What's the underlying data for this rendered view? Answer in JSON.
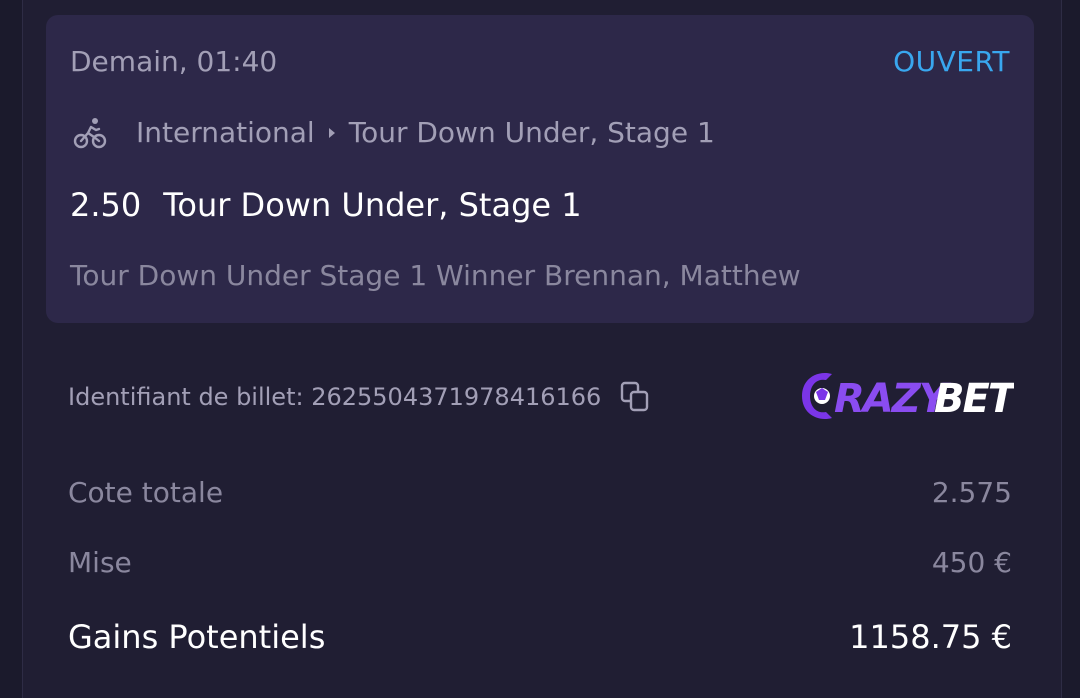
{
  "bet": {
    "date": "Demain, 01:40",
    "status": "OUVERT",
    "sport_icon": "bicycle-icon",
    "league": "International",
    "stage": "Tour Down Under, Stage 1",
    "odds": "2.50",
    "event": "Tour Down Under, Stage 1",
    "selection": "Tour Down Under Stage 1 Winner Brennan, Matthew"
  },
  "ticket": {
    "label": "Identifiant de billet: 2625504371978416166",
    "copy_icon": "copy-icon"
  },
  "logo": {
    "text": "CRAZYBET"
  },
  "summary": {
    "cote_label": "Cote totale",
    "cote_value": "2.575",
    "mise_label": "Mise",
    "mise_value": "450 €",
    "gains_label": "Gains Potentiels",
    "gains_value": "1158.75 €"
  },
  "colors": {
    "background": "#201e33",
    "card": "#2d2849",
    "status": "#39a7ef",
    "muted_text": "#a29fb6",
    "logo_purple": "#7b35e8"
  }
}
